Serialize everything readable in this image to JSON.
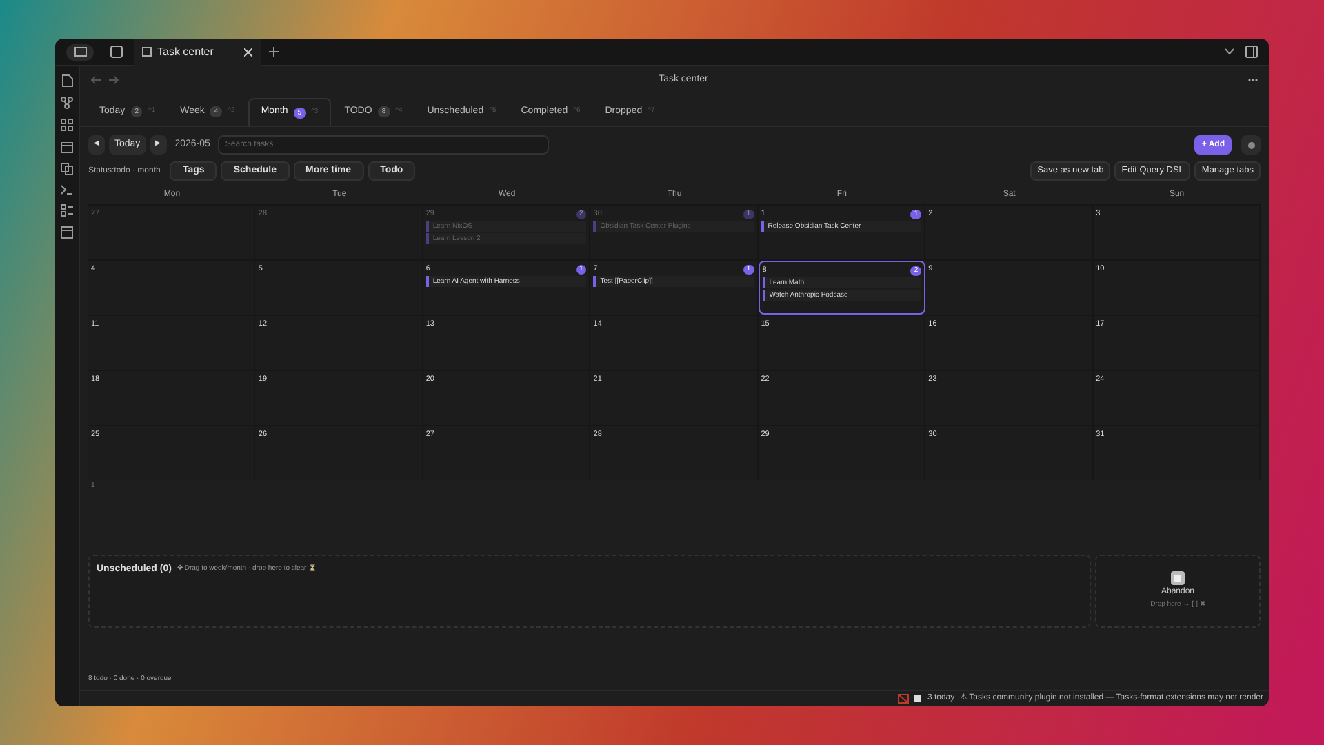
{
  "window": {
    "tab_title": "Task center",
    "title": "Task center"
  },
  "view_tabs": [
    {
      "label": "Today",
      "count": "2",
      "shortcut": "^1",
      "selected": false
    },
    {
      "label": "Week",
      "count": "4",
      "shortcut": "^2",
      "selected": false
    },
    {
      "label": "Month",
      "count": "5",
      "shortcut": "^3",
      "selected": true
    },
    {
      "label": "TODO",
      "count": "8",
      "shortcut": "^4",
      "selected": false
    },
    {
      "label": "Unscheduled",
      "shortcut": "^5",
      "selected": false
    },
    {
      "label": "Completed",
      "shortcut": "^6",
      "selected": false
    },
    {
      "label": "Dropped",
      "shortcut": "^7",
      "selected": false
    }
  ],
  "toolbar": {
    "prev": "◀",
    "today": "Today",
    "next": "▶",
    "period": "2026-05",
    "search_placeholder": "Search tasks",
    "add": "+ Add"
  },
  "filters": {
    "summary": "Status:todo · month",
    "buttons": [
      "Tags",
      "Schedule",
      "More time",
      "Todo"
    ],
    "actions": [
      "Save as new tab",
      "Edit Query DSL",
      "Manage tabs"
    ]
  },
  "calendar": {
    "weekdays": [
      "Mon",
      "Tue",
      "Wed",
      "Thu",
      "Fri",
      "Sat",
      "Sun"
    ],
    "weeks": [
      [
        {
          "day": "27",
          "outside": true
        },
        {
          "day": "28",
          "outside": true
        },
        {
          "day": "29",
          "outside": true,
          "count": "2",
          "tasks": [
            "Learn NixOS",
            "Learn Lesson 2"
          ]
        },
        {
          "day": "30",
          "outside": true,
          "count": "1",
          "tasks": [
            "Obsidian Task Center Plugins"
          ]
        },
        {
          "day": "1",
          "count": "1",
          "tasks": [
            "Release Obsidian Task Center"
          ]
        },
        {
          "day": "2"
        },
        {
          "day": "3"
        }
      ],
      [
        {
          "day": "4"
        },
        {
          "day": "5"
        },
        {
          "day": "6",
          "count": "1",
          "tasks": [
            "Learn AI Agent with Harness"
          ]
        },
        {
          "day": "7",
          "count": "1",
          "tasks": [
            "Test [[PaperClip]]"
          ]
        },
        {
          "day": "8",
          "count": "2",
          "selected": true,
          "tasks": [
            "Learn Math",
            "Watch Anthropic Podcase"
          ]
        },
        {
          "day": "9"
        },
        {
          "day": "10"
        }
      ],
      [
        {
          "day": "11"
        },
        {
          "day": "12"
        },
        {
          "day": "13"
        },
        {
          "day": "14"
        },
        {
          "day": "15"
        },
        {
          "day": "16"
        },
        {
          "day": "17"
        }
      ],
      [
        {
          "day": "18"
        },
        {
          "day": "19"
        },
        {
          "day": "20"
        },
        {
          "day": "21"
        },
        {
          "day": "22"
        },
        {
          "day": "23"
        },
        {
          "day": "24"
        }
      ],
      [
        {
          "day": "25"
        },
        {
          "day": "26"
        },
        {
          "day": "27"
        },
        {
          "day": "28"
        },
        {
          "day": "29"
        },
        {
          "day": "30"
        },
        {
          "day": "31"
        }
      ]
    ],
    "overflow_day": "1"
  },
  "unscheduled": {
    "title": "Unscheduled (0)",
    "hint": "✥ Drag to week/month · drop here to clear ⏳"
  },
  "abandon": {
    "label": "Abandon",
    "hint": "Drop here → [-] ✖"
  },
  "footer": "8 todo · 0 done · 0 overdue",
  "status_bar": {
    "today": "3 today",
    "warning": "⚠ Tasks community plugin not installed — Tasks-format extensions may not render"
  }
}
